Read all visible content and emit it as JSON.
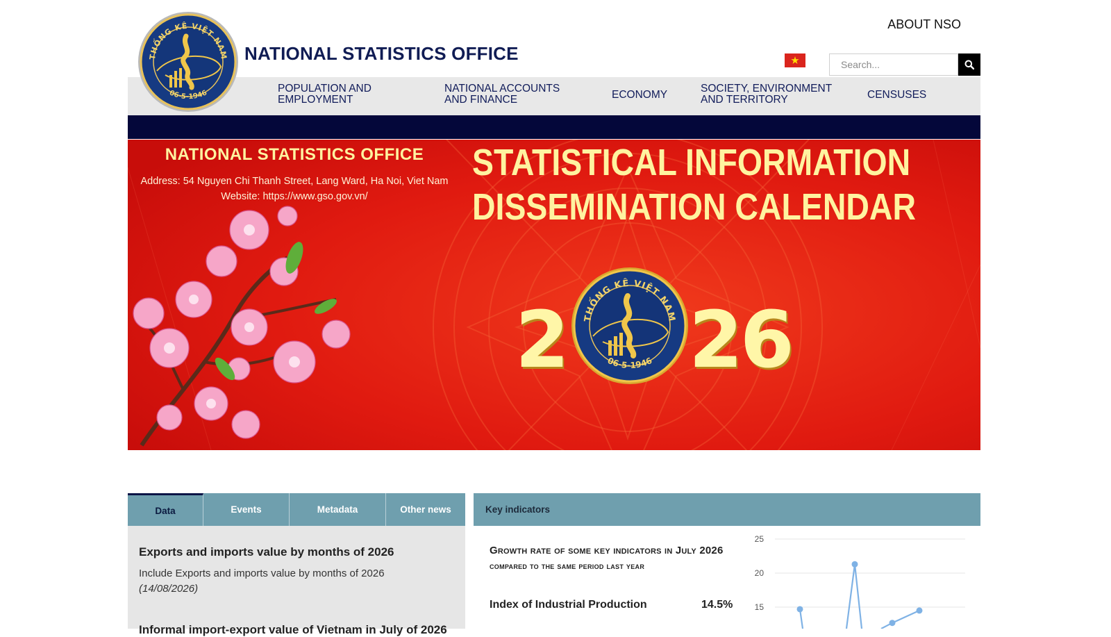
{
  "header": {
    "site_title": "NATIONAL STATISTICS OFFICE",
    "about_link": "ABOUT NSO",
    "search_placeholder": "Search...",
    "logo_top_text": "THỐNG KÊ VIỆT NAM",
    "logo_bottom_text": "06-5-1946",
    "flag": "vietnam-flag"
  },
  "nav": {
    "items": [
      {
        "line1": "POPULATION AND",
        "line2": "EMPLOYMENT"
      },
      {
        "line1": "NATIONAL ACCOUNTS",
        "line2": "AND FINANCE"
      },
      {
        "line1": "ECONOMY",
        "line2": ""
      },
      {
        "line1": "SOCIETY, ENVIRONMENT",
        "line2": "AND TERRITORY"
      },
      {
        "line1": "CENSUSES",
        "line2": ""
      }
    ]
  },
  "banner": {
    "org_title": "NATIONAL STATISTICS OFFICE",
    "address": "Address: 54 Nguyen Chi Thanh Street, Lang Ward, Ha Noi, Viet Nam",
    "website": "Website: https://www.gso.gov.vn/",
    "heading_line1": "STATISTICAL INFORMATION",
    "heading_line2": "DISSEMINATION CALENDAR",
    "year_left": "2",
    "year_right": "26",
    "emblem_top_text": "THỐNG KÊ VIỆT NAM",
    "emblem_bottom_text": "06-5-1946",
    "colors": {
      "bg": "#e3170f",
      "text": "#fff3a0"
    }
  },
  "tabs": {
    "items": [
      "Data",
      "Events",
      "Metadata",
      "Other news"
    ],
    "active": "Data"
  },
  "news": {
    "title": "Exports and imports value by months of 2026",
    "description": "Include Exports and imports value by months of 2026",
    "date": "(14/08/2026)",
    "next_title": "Informal import-export value of Vietnam in July of 2026"
  },
  "key_indicators": {
    "header": "Key indicators",
    "subtitle_line1": "Growth rate of some key indicators in July 2026",
    "subtitle_line2": "compared to the same period last year",
    "indicator_name": "Index of Industrial Production",
    "indicator_value": "14.5%"
  },
  "chart_data": {
    "type": "line",
    "y_ticks": [
      "25",
      "20",
      "15"
    ],
    "ylim": [
      13,
      25
    ],
    "grid": true,
    "series": [
      {
        "values": [
          14.7,
          21.3,
          13.5,
          14.5
        ],
        "x_index": [
          1,
          2,
          3,
          4
        ]
      }
    ],
    "colors": {
      "line": "#7fb2e5"
    }
  }
}
